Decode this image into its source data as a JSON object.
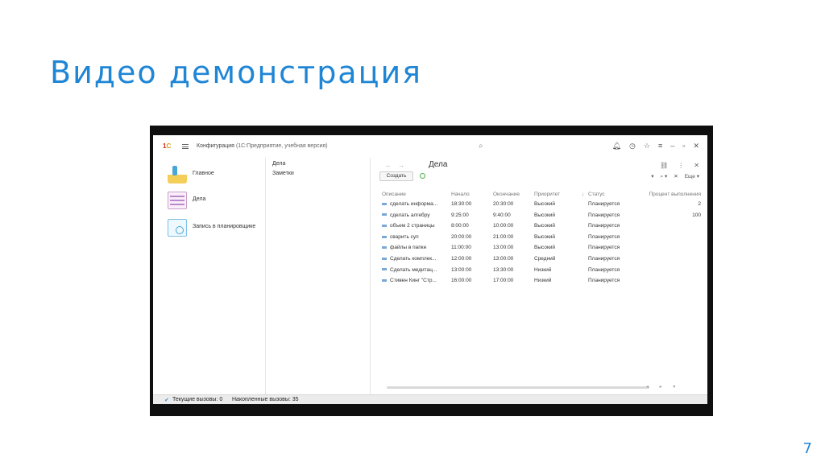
{
  "slide": {
    "title": "Видео демонстрация",
    "page_number": "7"
  },
  "app": {
    "title": "Конфигурация",
    "subtitle": "(1С:Предприятие, учебная версия)"
  },
  "leftnav": {
    "items": [
      {
        "label": "Главное",
        "icon": "home-icon"
      },
      {
        "label": "Дела",
        "icon": "tasks-icon"
      },
      {
        "label": "Запись в планировщике",
        "icon": "scheduler-icon"
      }
    ]
  },
  "sections": [
    "Дела",
    "Заметки"
  ],
  "form": {
    "title": "Дела",
    "create_label": "Создать",
    "more_label": "Еще"
  },
  "table": {
    "columns": [
      "Описание",
      "Начало",
      "Окончание",
      "Приоритет",
      "Статус",
      "Процент выполнения"
    ],
    "sort_indicator": "↓",
    "rows": [
      {
        "desc": "сделать информа...",
        "start": "18:30:00",
        "end": "20:30:00",
        "prio": "Высокий",
        "status": "Планируется",
        "pct": "2"
      },
      {
        "desc": "сделать алгебру",
        "start": "9:25:00",
        "end": "9:40:00",
        "prio": "Высокий",
        "status": "Планируется",
        "pct": "100"
      },
      {
        "desc": "объем 2 страницы",
        "start": "8:00:00",
        "end": "10:00:00",
        "prio": "Высокий",
        "status": "Планируется",
        "pct": ""
      },
      {
        "desc": "сварить суп",
        "start": "20:00:00",
        "end": "21:00:00",
        "prio": "Высокий",
        "status": "Планируется",
        "pct": ""
      },
      {
        "desc": "файлы в папке",
        "start": "11:00:00",
        "end": "13:00:00",
        "prio": "Высокий",
        "status": "Планируется",
        "pct": ""
      },
      {
        "desc": "Сделать комплек...",
        "start": "12:00:00",
        "end": "13:00:00",
        "prio": "Средний",
        "status": "Планируется",
        "pct": ""
      },
      {
        "desc": "Сделать медитац...",
        "start": "13:00:00",
        "end": "13:30:00",
        "prio": "Низкий",
        "status": "Планируется",
        "pct": ""
      },
      {
        "desc": "Стивен Кинг \"Стр...",
        "start": "16:00:00",
        "end": "17:00:00",
        "prio": "Низкий",
        "status": "Планируется",
        "pct": ""
      }
    ]
  },
  "statusbar": {
    "current_calls": "Текущие вызовы: 0",
    "accumulated_calls": "Накопленные вызовы: 35"
  },
  "colors": {
    "accent": "#1f86d6",
    "frame": "#0f0f0f"
  }
}
